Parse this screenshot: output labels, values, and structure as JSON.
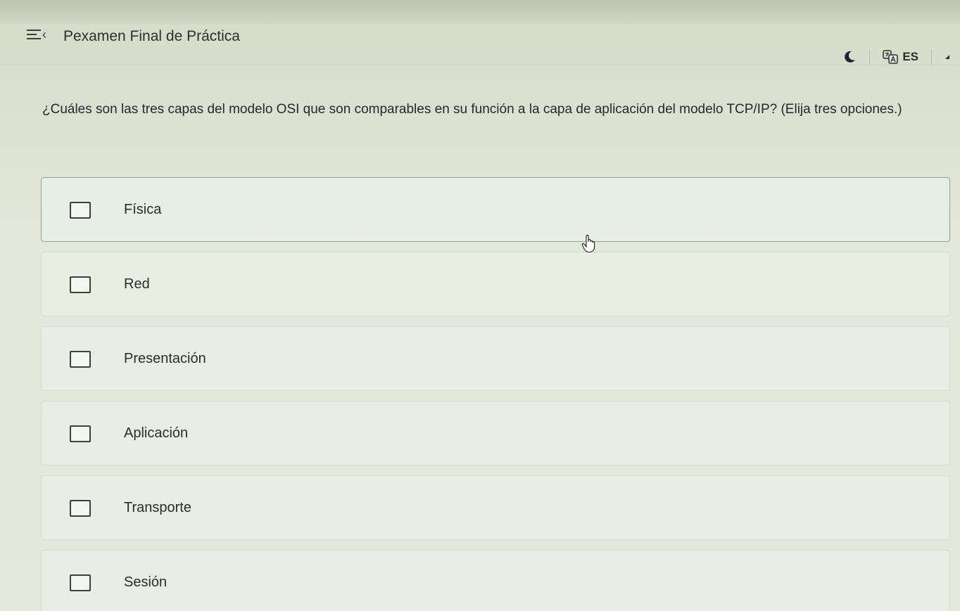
{
  "header": {
    "title": "Pexamen Final de Práctica",
    "language": "ES",
    "icons": {
      "menu": "hamburger-icon",
      "back": "chevron-left-icon",
      "theme": "moon-icon",
      "translate": "translate-icon"
    }
  },
  "question": {
    "text": "¿Cuáles son las tres capas del modelo OSI que son comparables en su función a la capa de aplicación del modelo TCP/IP? (Elija tres opciones.)"
  },
  "options": [
    {
      "label": "Física",
      "checked": false
    },
    {
      "label": "Red",
      "checked": false
    },
    {
      "label": "Presentación",
      "checked": false
    },
    {
      "label": "Aplicación",
      "checked": false
    },
    {
      "label": "Transporte",
      "checked": false
    },
    {
      "label": "Sesión",
      "checked": false
    }
  ],
  "colors": {
    "background": "#e3e8da",
    "text": "#2a2e2a",
    "hover_border": "#8fa392"
  }
}
